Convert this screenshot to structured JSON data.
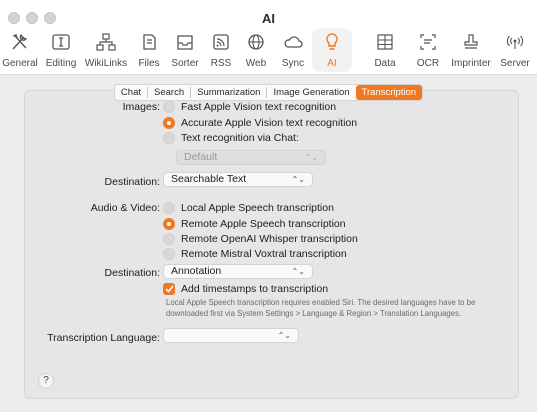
{
  "window": {
    "title": "AI"
  },
  "toolbar": {
    "items": [
      {
        "label": "General",
        "icon": "tools-icon"
      },
      {
        "label": "Editing",
        "icon": "text-cursor-icon"
      },
      {
        "label": "WikiLinks",
        "icon": "network-icon"
      },
      {
        "label": "Files",
        "icon": "files-icon"
      },
      {
        "label": "Sorter",
        "icon": "tray-icon"
      },
      {
        "label": "RSS",
        "icon": "rss-icon"
      },
      {
        "label": "Web",
        "icon": "globe-icon"
      },
      {
        "label": "Sync",
        "icon": "cloud-icon"
      },
      {
        "label": "AI",
        "icon": "lightbulb-icon",
        "active": true
      },
      {
        "label": "Data",
        "icon": "table-icon"
      },
      {
        "label": "OCR",
        "icon": "text-scan-icon"
      },
      {
        "label": "Imprinter",
        "icon": "stamp-icon"
      },
      {
        "label": "Server",
        "icon": "broadcast-icon"
      }
    ]
  },
  "tabs": [
    "Chat",
    "Search",
    "Summarization",
    "Image Generation",
    "Transcription"
  ],
  "active_tab": "Transcription",
  "images": {
    "label": "Images:",
    "options": [
      "Fast Apple Vision text recognition",
      "Accurate Apple Vision text recognition",
      "Text recognition via Chat:"
    ],
    "selected": "Accurate Apple Vision text recognition",
    "chat_model": "Default",
    "destination_label": "Destination:",
    "destination": "Searchable Text"
  },
  "audio_video": {
    "label": "Audio & Video:",
    "options": [
      "Local Apple Speech transcription",
      "Remote Apple Speech transcription",
      "Remote OpenAI Whisper transcription",
      "Remote Mistral Voxtral transcription"
    ],
    "selected": "Remote Apple Speech transcription",
    "destination_label": "Destination:",
    "destination": "Annotation",
    "timestamps_label": "Add timestamps to transcription",
    "timestamps_checked": true,
    "note": "Local Apple Speech transcription requires enabled Siri. The desired languages have to be downloaded first via System Settings > Language & Region > Translation Languages."
  },
  "language": {
    "label": "Transcription Language:",
    "value": ""
  },
  "help": "?",
  "colors": {
    "accent": "#f07820"
  }
}
